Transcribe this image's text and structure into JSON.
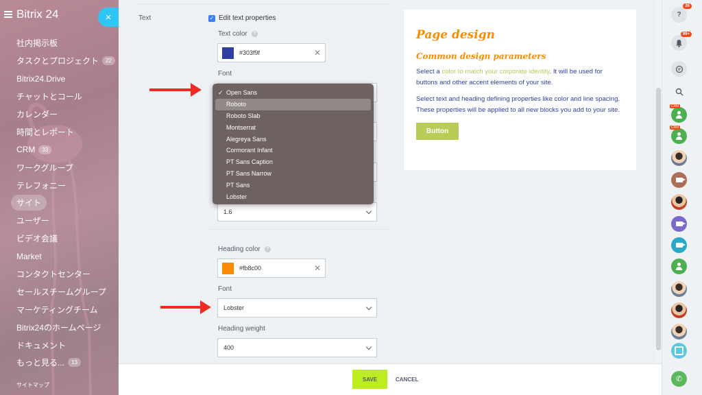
{
  "sidebar": {
    "logo": "Bitrix 24",
    "close": "×",
    "items": [
      {
        "label": "社内掲示板",
        "count": ""
      },
      {
        "label": "タスクとプロジェクト",
        "count": "22"
      },
      {
        "label": "Bitrix24.Drive",
        "count": ""
      },
      {
        "label": "チャットとコール",
        "count": ""
      },
      {
        "label": "カレンダー",
        "count": ""
      },
      {
        "label": "時間とレポート",
        "count": ""
      },
      {
        "label": "CRM",
        "count": "33"
      },
      {
        "label": "ワークグループ",
        "count": ""
      },
      {
        "label": "テレフォニー",
        "count": ""
      },
      {
        "label": "サイト",
        "count": ""
      },
      {
        "label": "ユーザー",
        "count": ""
      },
      {
        "label": "ビデオ会議",
        "count": ""
      },
      {
        "label": "Market",
        "count": ""
      },
      {
        "label": "コンタクトセンター",
        "count": ""
      },
      {
        "label": "セールスチームグループ",
        "count": ""
      },
      {
        "label": "マーケティングチーム",
        "count": ""
      },
      {
        "label": "Bitrix24のホームページ",
        "count": ""
      },
      {
        "label": "ドキュメント",
        "count": ""
      },
      {
        "label": "もっと見る...",
        "count": "13"
      }
    ],
    "sitemap": "サイトマップ"
  },
  "form": {
    "row_label": "Text",
    "edit_text_properties": "Edit text properties",
    "text_color_label": "Text color",
    "text_color_value": "#303f9f",
    "font_label": "Font",
    "line_spacing_value": "1.6",
    "heading_color_label": "Heading color",
    "heading_color_value": "#fb8c00",
    "heading_font_label": "Font",
    "heading_font_value": "Lobster",
    "heading_weight_label": "Heading weight",
    "heading_weight_value": "400"
  },
  "dropdown": {
    "selected": "Open Sans",
    "hovered": "Roboto",
    "options": [
      "Open Sans",
      "Roboto",
      "Roboto Slab",
      "Montserrat",
      "Alegreya Sans",
      "Cormorant Infant",
      "PT Sans Caption",
      "PT Sans Narrow",
      "PT Sans",
      "Lobster"
    ]
  },
  "preview": {
    "title": "Page design",
    "subtitle": "Common design parameters",
    "p1_a": "Select a ",
    "p1_link": "color to match your corporate identity",
    "p1_b": ". It will be used for buttons and other accent elements of your site.",
    "p2": "Select text and heading defining properties like color and line spacing. These properties will be applied to all new blocks you add to your site.",
    "button": "Button"
  },
  "footer": {
    "save": "SAVE",
    "cancel": "CANCEL"
  },
  "rail": {
    "help_badge": "26",
    "notif_badge": "99+",
    "crm_tag": "CRM"
  },
  "colors": {
    "text_color": "#303f9f",
    "heading_color": "#fb8c00",
    "accent": "#bbed21"
  }
}
